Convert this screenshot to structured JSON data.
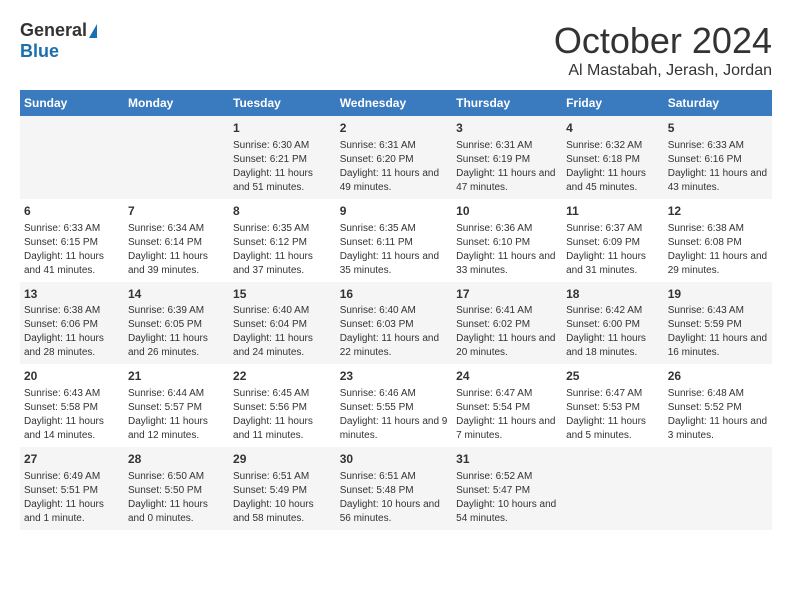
{
  "header": {
    "logo_general": "General",
    "logo_blue": "Blue",
    "month": "October 2024",
    "location": "Al Mastabah, Jerash, Jordan"
  },
  "calendar": {
    "weekdays": [
      "Sunday",
      "Monday",
      "Tuesday",
      "Wednesday",
      "Thursday",
      "Friday",
      "Saturday"
    ],
    "weeks": [
      [
        {
          "day": "",
          "info": ""
        },
        {
          "day": "",
          "info": ""
        },
        {
          "day": "1",
          "sunrise": "6:30 AM",
          "sunset": "6:21 PM",
          "daylight": "11 hours and 51 minutes."
        },
        {
          "day": "2",
          "sunrise": "6:31 AM",
          "sunset": "6:20 PM",
          "daylight": "11 hours and 49 minutes."
        },
        {
          "day": "3",
          "sunrise": "6:31 AM",
          "sunset": "6:19 PM",
          "daylight": "11 hours and 47 minutes."
        },
        {
          "day": "4",
          "sunrise": "6:32 AM",
          "sunset": "6:18 PM",
          "daylight": "11 hours and 45 minutes."
        },
        {
          "day": "5",
          "sunrise": "6:33 AM",
          "sunset": "6:16 PM",
          "daylight": "11 hours and 43 minutes."
        }
      ],
      [
        {
          "day": "6",
          "sunrise": "6:33 AM",
          "sunset": "6:15 PM",
          "daylight": "11 hours and 41 minutes."
        },
        {
          "day": "7",
          "sunrise": "6:34 AM",
          "sunset": "6:14 PM",
          "daylight": "11 hours and 39 minutes."
        },
        {
          "day": "8",
          "sunrise": "6:35 AM",
          "sunset": "6:12 PM",
          "daylight": "11 hours and 37 minutes."
        },
        {
          "day": "9",
          "sunrise": "6:35 AM",
          "sunset": "6:11 PM",
          "daylight": "11 hours and 35 minutes."
        },
        {
          "day": "10",
          "sunrise": "6:36 AM",
          "sunset": "6:10 PM",
          "daylight": "11 hours and 33 minutes."
        },
        {
          "day": "11",
          "sunrise": "6:37 AM",
          "sunset": "6:09 PM",
          "daylight": "11 hours and 31 minutes."
        },
        {
          "day": "12",
          "sunrise": "6:38 AM",
          "sunset": "6:08 PM",
          "daylight": "11 hours and 29 minutes."
        }
      ],
      [
        {
          "day": "13",
          "sunrise": "6:38 AM",
          "sunset": "6:06 PM",
          "daylight": "11 hours and 28 minutes."
        },
        {
          "day": "14",
          "sunrise": "6:39 AM",
          "sunset": "6:05 PM",
          "daylight": "11 hours and 26 minutes."
        },
        {
          "day": "15",
          "sunrise": "6:40 AM",
          "sunset": "6:04 PM",
          "daylight": "11 hours and 24 minutes."
        },
        {
          "day": "16",
          "sunrise": "6:40 AM",
          "sunset": "6:03 PM",
          "daylight": "11 hours and 22 minutes."
        },
        {
          "day": "17",
          "sunrise": "6:41 AM",
          "sunset": "6:02 PM",
          "daylight": "11 hours and 20 minutes."
        },
        {
          "day": "18",
          "sunrise": "6:42 AM",
          "sunset": "6:00 PM",
          "daylight": "11 hours and 18 minutes."
        },
        {
          "day": "19",
          "sunrise": "6:43 AM",
          "sunset": "5:59 PM",
          "daylight": "11 hours and 16 minutes."
        }
      ],
      [
        {
          "day": "20",
          "sunrise": "6:43 AM",
          "sunset": "5:58 PM",
          "daylight": "11 hours and 14 minutes."
        },
        {
          "day": "21",
          "sunrise": "6:44 AM",
          "sunset": "5:57 PM",
          "daylight": "11 hours and 12 minutes."
        },
        {
          "day": "22",
          "sunrise": "6:45 AM",
          "sunset": "5:56 PM",
          "daylight": "11 hours and 11 minutes."
        },
        {
          "day": "23",
          "sunrise": "6:46 AM",
          "sunset": "5:55 PM",
          "daylight": "11 hours and 9 minutes."
        },
        {
          "day": "24",
          "sunrise": "6:47 AM",
          "sunset": "5:54 PM",
          "daylight": "11 hours and 7 minutes."
        },
        {
          "day": "25",
          "sunrise": "6:47 AM",
          "sunset": "5:53 PM",
          "daylight": "11 hours and 5 minutes."
        },
        {
          "day": "26",
          "sunrise": "6:48 AM",
          "sunset": "5:52 PM",
          "daylight": "11 hours and 3 minutes."
        }
      ],
      [
        {
          "day": "27",
          "sunrise": "6:49 AM",
          "sunset": "5:51 PM",
          "daylight": "11 hours and 1 minute."
        },
        {
          "day": "28",
          "sunrise": "6:50 AM",
          "sunset": "5:50 PM",
          "daylight": "11 hours and 0 minutes."
        },
        {
          "day": "29",
          "sunrise": "6:51 AM",
          "sunset": "5:49 PM",
          "daylight": "10 hours and 58 minutes."
        },
        {
          "day": "30",
          "sunrise": "6:51 AM",
          "sunset": "5:48 PM",
          "daylight": "10 hours and 56 minutes."
        },
        {
          "day": "31",
          "sunrise": "6:52 AM",
          "sunset": "5:47 PM",
          "daylight": "10 hours and 54 minutes."
        },
        {
          "day": "",
          "info": ""
        },
        {
          "day": "",
          "info": ""
        }
      ]
    ]
  }
}
